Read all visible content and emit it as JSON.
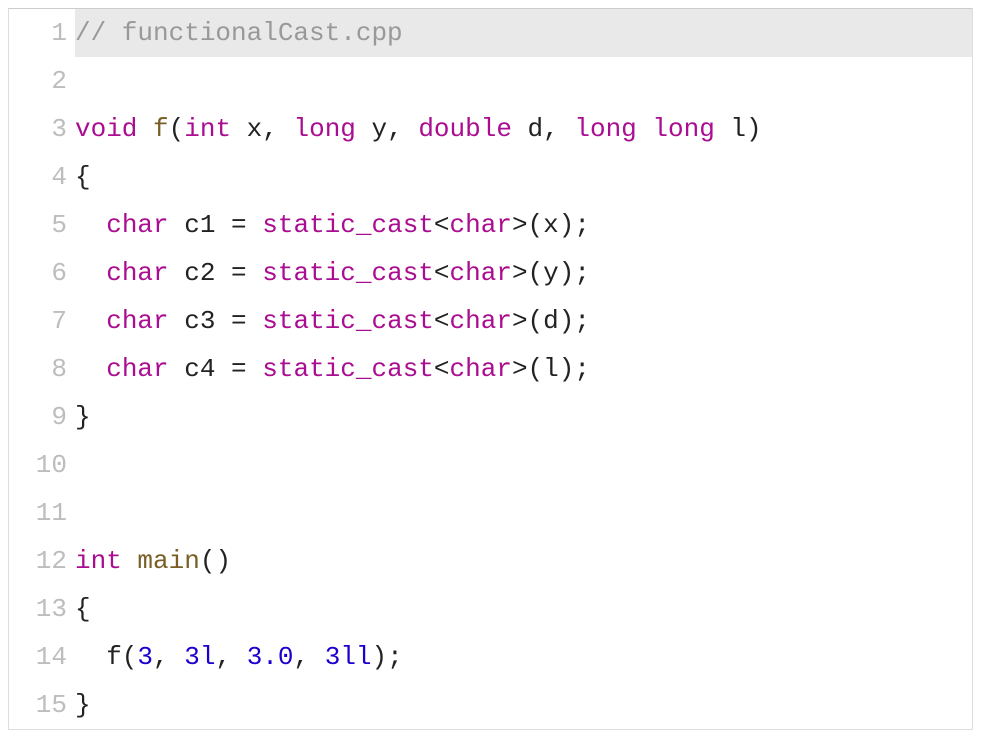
{
  "lines": [
    {
      "n": "1",
      "highlight": true,
      "tokens": [
        {
          "cls": "t-comment",
          "text": "// functionalCast.cpp"
        }
      ]
    },
    {
      "n": "2",
      "tokens": []
    },
    {
      "n": "3",
      "tokens": [
        {
          "cls": "t-keyword",
          "text": "void"
        },
        {
          "cls": "t-default",
          "text": " "
        },
        {
          "cls": "t-func",
          "text": "f"
        },
        {
          "cls": "t-default",
          "text": "("
        },
        {
          "cls": "t-keyword",
          "text": "int"
        },
        {
          "cls": "t-default",
          "text": " x, "
        },
        {
          "cls": "t-keyword",
          "text": "long"
        },
        {
          "cls": "t-default",
          "text": " y, "
        },
        {
          "cls": "t-keyword",
          "text": "double"
        },
        {
          "cls": "t-default",
          "text": " d, "
        },
        {
          "cls": "t-keyword",
          "text": "long long"
        },
        {
          "cls": "t-default",
          "text": " l)"
        }
      ]
    },
    {
      "n": "4",
      "tokens": [
        {
          "cls": "t-default",
          "text": "{"
        }
      ]
    },
    {
      "n": "5",
      "tokens": [
        {
          "cls": "t-default",
          "text": "  "
        },
        {
          "cls": "t-keyword",
          "text": "char"
        },
        {
          "cls": "t-default",
          "text": " c1 = "
        },
        {
          "cls": "t-keyword",
          "text": "static_cast"
        },
        {
          "cls": "t-default",
          "text": "<"
        },
        {
          "cls": "t-keyword",
          "text": "char"
        },
        {
          "cls": "t-default",
          "text": ">(x);"
        }
      ]
    },
    {
      "n": "6",
      "tokens": [
        {
          "cls": "t-default",
          "text": "  "
        },
        {
          "cls": "t-keyword",
          "text": "char"
        },
        {
          "cls": "t-default",
          "text": " c2 = "
        },
        {
          "cls": "t-keyword",
          "text": "static_cast"
        },
        {
          "cls": "t-default",
          "text": "<"
        },
        {
          "cls": "t-keyword",
          "text": "char"
        },
        {
          "cls": "t-default",
          "text": ">(y);"
        }
      ]
    },
    {
      "n": "7",
      "tokens": [
        {
          "cls": "t-default",
          "text": "  "
        },
        {
          "cls": "t-keyword",
          "text": "char"
        },
        {
          "cls": "t-default",
          "text": " c3 = "
        },
        {
          "cls": "t-keyword",
          "text": "static_cast"
        },
        {
          "cls": "t-default",
          "text": "<"
        },
        {
          "cls": "t-keyword",
          "text": "char"
        },
        {
          "cls": "t-default",
          "text": ">(d);"
        }
      ]
    },
    {
      "n": "8",
      "tokens": [
        {
          "cls": "t-default",
          "text": "  "
        },
        {
          "cls": "t-keyword",
          "text": "char"
        },
        {
          "cls": "t-default",
          "text": " c4 = "
        },
        {
          "cls": "t-keyword",
          "text": "static_cast"
        },
        {
          "cls": "t-default",
          "text": "<"
        },
        {
          "cls": "t-keyword",
          "text": "char"
        },
        {
          "cls": "t-default",
          "text": ">(l);"
        }
      ]
    },
    {
      "n": "9",
      "tokens": [
        {
          "cls": "t-default",
          "text": "}"
        }
      ]
    },
    {
      "n": "10",
      "tokens": []
    },
    {
      "n": "11",
      "tokens": []
    },
    {
      "n": "12",
      "tokens": [
        {
          "cls": "t-keyword",
          "text": "int"
        },
        {
          "cls": "t-default",
          "text": " "
        },
        {
          "cls": "t-func",
          "text": "main"
        },
        {
          "cls": "t-default",
          "text": "()"
        }
      ]
    },
    {
      "n": "13",
      "tokens": [
        {
          "cls": "t-default",
          "text": "{"
        }
      ]
    },
    {
      "n": "14",
      "tokens": [
        {
          "cls": "t-default",
          "text": "  f("
        },
        {
          "cls": "t-number",
          "text": "3"
        },
        {
          "cls": "t-default",
          "text": ", "
        },
        {
          "cls": "t-number",
          "text": "3l"
        },
        {
          "cls": "t-default",
          "text": ", "
        },
        {
          "cls": "t-number",
          "text": "3.0"
        },
        {
          "cls": "t-default",
          "text": ", "
        },
        {
          "cls": "t-number",
          "text": "3ll"
        },
        {
          "cls": "t-default",
          "text": ");"
        }
      ]
    },
    {
      "n": "15",
      "tokens": [
        {
          "cls": "t-default",
          "text": "}"
        }
      ]
    }
  ]
}
